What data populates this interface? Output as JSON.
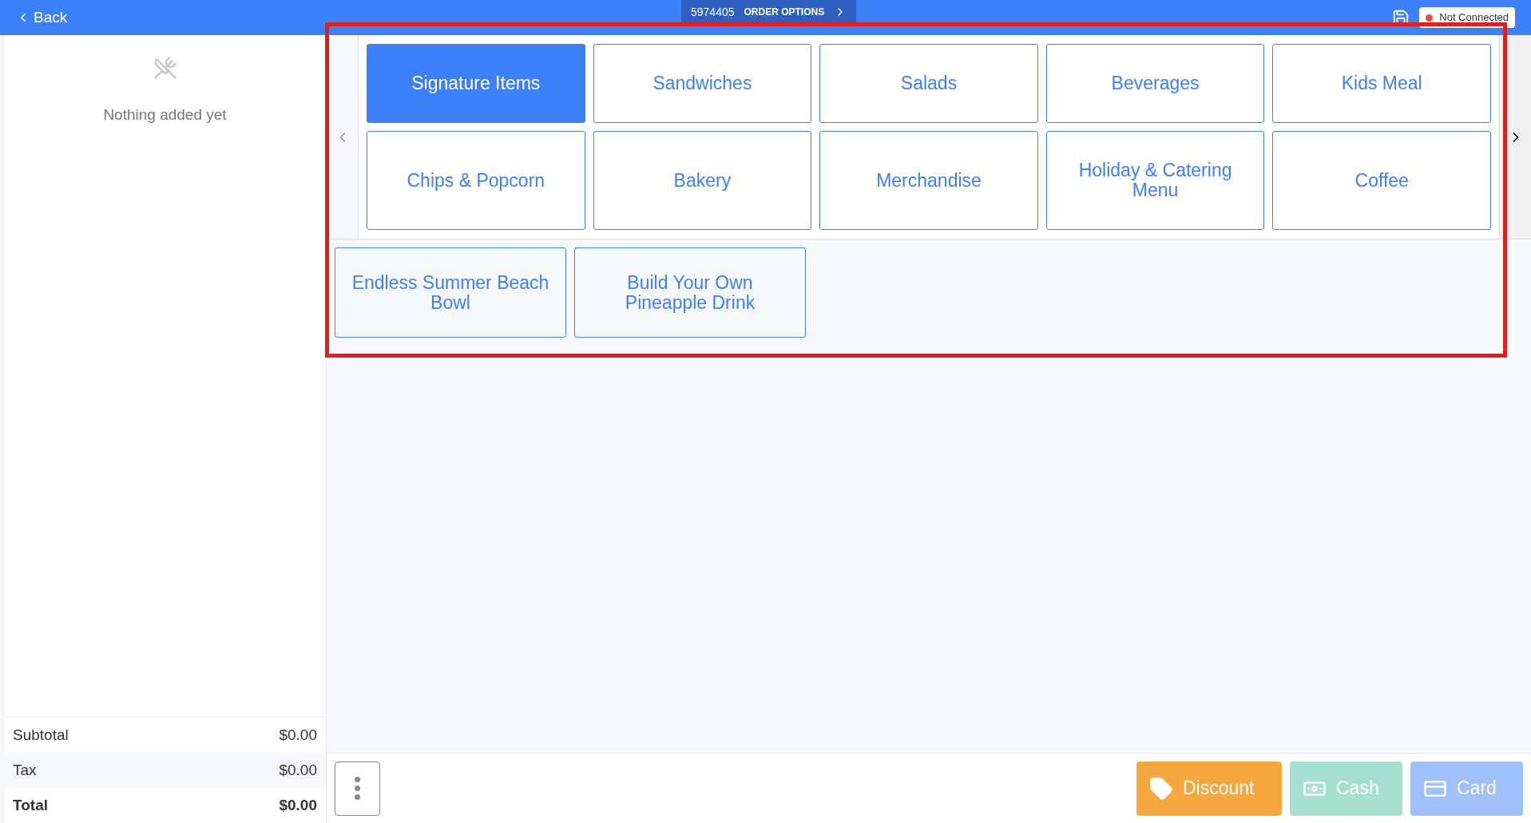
{
  "top_bar": {
    "back_label": "Back",
    "order_number": "5974405",
    "order_options": "ORDER OPTIONS",
    "connection": {
      "label": "Not Connected",
      "connected": false
    }
  },
  "order": {
    "empty_message": "Nothing added yet",
    "totals": [
      {
        "label": "Subtotal",
        "value": "$0.00",
        "bold": false
      },
      {
        "label": "Tax",
        "value": "$0.00",
        "bold": false
      },
      {
        "label": "Total",
        "value": "$0.00",
        "bold": true
      }
    ]
  },
  "categories": [
    {
      "label": "Signature Items",
      "selected": true
    },
    {
      "label": "Sandwiches",
      "selected": false
    },
    {
      "label": "Salads",
      "selected": false
    },
    {
      "label": "Beverages",
      "selected": false
    },
    {
      "label": "Kids Meal",
      "selected": false
    },
    {
      "label": "Chips & Popcorn",
      "selected": false
    },
    {
      "label": "Bakery",
      "selected": false
    },
    {
      "label": "Merchandise",
      "selected": false
    },
    {
      "label": "Holiday & Catering Menu",
      "selected": false
    },
    {
      "label": "Coffee",
      "selected": false
    }
  ],
  "products": [
    {
      "label": "Endless Summer Beach Bowl"
    },
    {
      "label": "Build Your Own Pineapple Drink"
    }
  ],
  "actions": [
    {
      "kind": "discount",
      "label": "Discount",
      "disabled": false
    },
    {
      "kind": "cash",
      "label": "Cash",
      "disabled": true
    },
    {
      "kind": "card",
      "label": "Card",
      "disabled": true
    }
  ]
}
